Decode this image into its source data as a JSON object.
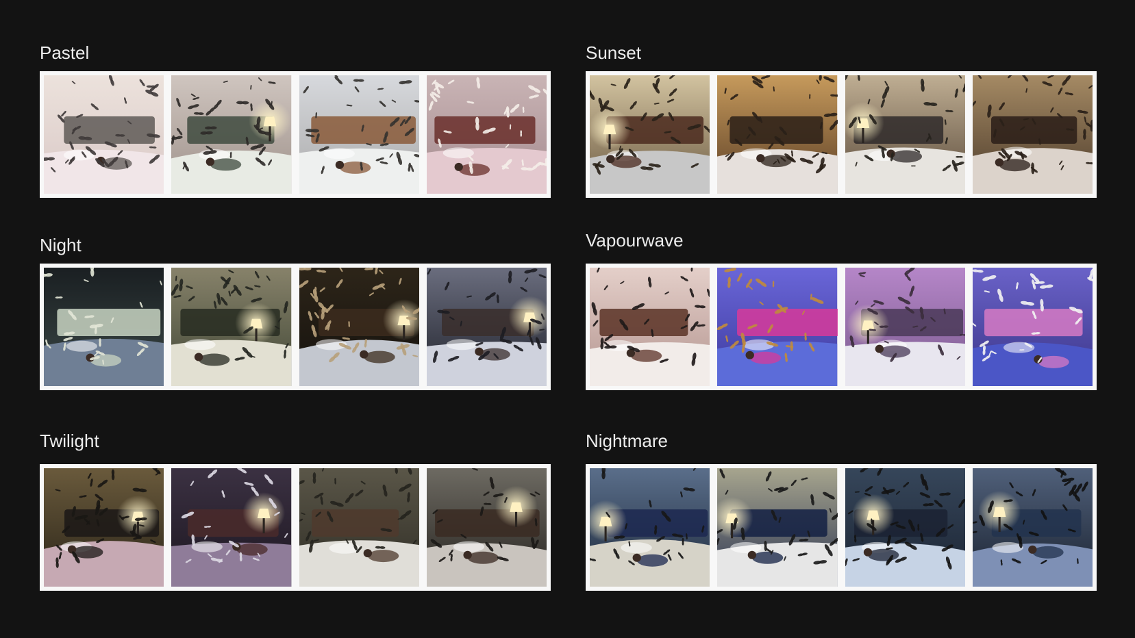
{
  "groups": [
    {
      "id": "pastel",
      "title": "Pastel",
      "thumbs": [
        {
          "bg": [
            "#ece2dc",
            "#d9c8c6"
          ],
          "bed": "#f1e6e8",
          "accent": "#5f5a57",
          "swarm": "#3f3a3a",
          "light": false
        },
        {
          "bg": [
            "#cfc5bf",
            "#9e918a"
          ],
          "bed": "#e8ebe4",
          "accent": "#3f4b3f",
          "swarm": "#2e2a28",
          "light": true
        },
        {
          "bg": [
            "#d7d9dd",
            "#a9a9a9"
          ],
          "bed": "#eef0ef",
          "accent": "#8a5a3a",
          "swarm": "#34322f",
          "light": false
        },
        {
          "bg": [
            "#c9b4b5",
            "#a48a8e"
          ],
          "bed": "#e4c9cf",
          "accent": "#6a2f2b",
          "swarm": "#f4ede8",
          "light": false
        }
      ]
    },
    {
      "id": "sunset",
      "title": "Sunset",
      "thumbs": [
        {
          "bg": [
            "#d2c3a0",
            "#6d5b43"
          ],
          "bed": "#c7c7c7",
          "accent": "#4b2a1f",
          "swarm": "#2a2219",
          "light": true
        },
        {
          "bg": [
            "#c69a5c",
            "#5b3e25"
          ],
          "bed": "#e6e0dc",
          "accent": "#2b2018",
          "swarm": "#2a2018",
          "light": false
        },
        {
          "bg": [
            "#bfae93",
            "#5a4a3a"
          ],
          "bed": "#e7e4df",
          "accent": "#2f2a2a",
          "swarm": "#26221d",
          "light": true
        },
        {
          "bg": [
            "#a58a64",
            "#4b3a2a"
          ],
          "bed": "#dcd3cb",
          "accent": "#2a1d18",
          "swarm": "#2a2018",
          "light": false
        }
      ]
    },
    {
      "id": "night",
      "title": "Night",
      "thumbs": [
        {
          "bg": [
            "#1a1f22",
            "#3b4846"
          ],
          "bed": "#6f7f95",
          "accent": "#c8d3c2",
          "swarm": "#e2e6d6",
          "light": false
        },
        {
          "bg": [
            "#87826a",
            "#414736"
          ],
          "bed": "#e2e0d2",
          "accent": "#272b21",
          "swarm": "#232620",
          "light": true
        },
        {
          "bg": [
            "#2d2519",
            "#14110d"
          ],
          "bed": "#c3c7cf",
          "accent": "#3c2c1d",
          "swarm": "#b7a07a",
          "light": true
        },
        {
          "bg": [
            "#6a6d7e",
            "#20222b"
          ],
          "bed": "#cfd2dd",
          "accent": "#3a2e2c",
          "swarm": "#1d1d22",
          "light": true
        }
      ]
    },
    {
      "id": "vapourwave",
      "title": "Vapourwave",
      "thumbs": [
        {
          "bg": [
            "#e4cfc9",
            "#b3948f"
          ],
          "bed": "#f2ece9",
          "accent": "#5b3226",
          "swarm": "#1f1a19",
          "light": false
        },
        {
          "bg": [
            "#6a66d8",
            "#3c3a9d"
          ],
          "bed": "#5c6cd9",
          "accent": "#d7399a",
          "swarm": "#c08b3c",
          "light": false
        },
        {
          "bg": [
            "#b586c8",
            "#7a5a8e"
          ],
          "bed": "#e8e6ef",
          "accent": "#4a3a58",
          "swarm": "#3b2e3c",
          "light": true
        },
        {
          "bg": [
            "#6a62c8",
            "#3a3588"
          ],
          "bed": "#4b56c6",
          "accent": "#d67ac4",
          "swarm": "#f2f2f2",
          "light": false
        }
      ]
    },
    {
      "id": "twilight",
      "title": "Twilight",
      "thumbs": [
        {
          "bg": [
            "#6a5a3c",
            "#2a2418"
          ],
          "bed": "#c6a9b3",
          "accent": "#1b1816",
          "swarm": "#1a1714",
          "light": true
        },
        {
          "bg": [
            "#3b3142",
            "#1c1620"
          ],
          "bed": "#8f7c99",
          "accent": "#4a2a2a",
          "swarm": "#dcd8e2",
          "light": true
        },
        {
          "bg": [
            "#5a5648",
            "#2f2d25"
          ],
          "bed": "#e0ded8",
          "accent": "#4f3a2d",
          "swarm": "#25231e",
          "light": false
        },
        {
          "bg": [
            "#6d6a62",
            "#26231f"
          ],
          "bed": "#c9c4be",
          "accent": "#3a2a22",
          "swarm": "#1c1a17",
          "light": true
        }
      ]
    },
    {
      "id": "nightmare",
      "title": "Nightmare",
      "thumbs": [
        {
          "bg": [
            "#5a6e8a",
            "#1e2a3c"
          ],
          "bed": "#d6d3c8",
          "accent": "#1c2850",
          "swarm": "#171717",
          "light": true
        },
        {
          "bg": [
            "#a7a58e",
            "#2c3552"
          ],
          "bed": "#e6e6e6",
          "accent": "#132043",
          "swarm": "#1a1a1a",
          "light": true
        },
        {
          "bg": [
            "#36465a",
            "#1b2433"
          ],
          "bed": "#c6d3e5",
          "accent": "#1b2233",
          "swarm": "#141414",
          "light": true
        },
        {
          "bg": [
            "#50607a",
            "#1a2230"
          ],
          "bed": "#7e90b5",
          "accent": "#22324d",
          "swarm": "#121212",
          "light": true
        }
      ]
    }
  ]
}
